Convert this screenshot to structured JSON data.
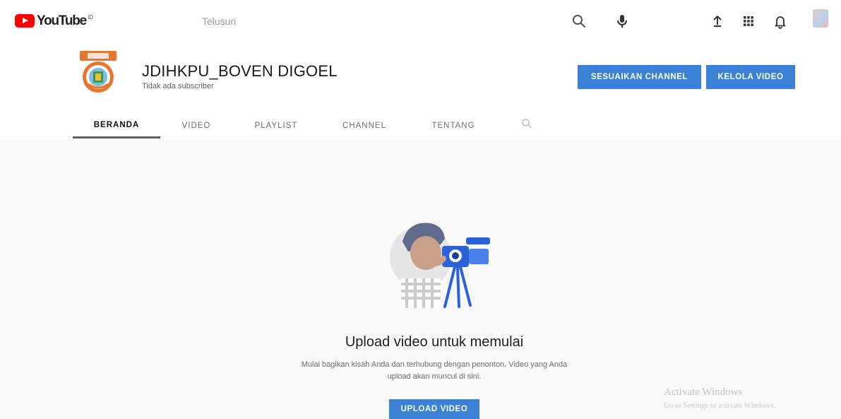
{
  "masthead": {
    "logo_text": "YouTube",
    "region": "ID",
    "search_placeholder": "Telusuri",
    "icons": [
      "search-icon",
      "mic-icon",
      "upload-icon",
      "apps-icon",
      "bell-icon",
      "avatar"
    ]
  },
  "channel": {
    "name": "JDIHKPU_BOVEN DIGOEL",
    "subscribers": "Tidak ada subscriber",
    "customize_button": "SESUAIKAN CHANNEL",
    "manage_button": "KELOLA VIDEO"
  },
  "tabs": [
    {
      "label": "BERANDA",
      "active": true
    },
    {
      "label": "VIDEO",
      "active": false
    },
    {
      "label": "PLAYLIST",
      "active": false
    },
    {
      "label": "CHANNEL",
      "active": false
    },
    {
      "label": "TENTANG",
      "active": false
    }
  ],
  "empty_state": {
    "title": "Upload video untuk memulai",
    "description_line1": "Mulai bagikan kisah Anda dan terhubung dengan penonton. Video yang Anda",
    "description_line2": "upload akan muncul di sini.",
    "upload_button": "UPLOAD VIDEO"
  },
  "watermark": {
    "title": "Activate Windows",
    "subtitle": "Go to Settings to activate Windows."
  },
  "colors": {
    "brand_red": "#ff0000",
    "accent_blue": "#3b82d6",
    "page_bg": "#f9f9f9"
  }
}
